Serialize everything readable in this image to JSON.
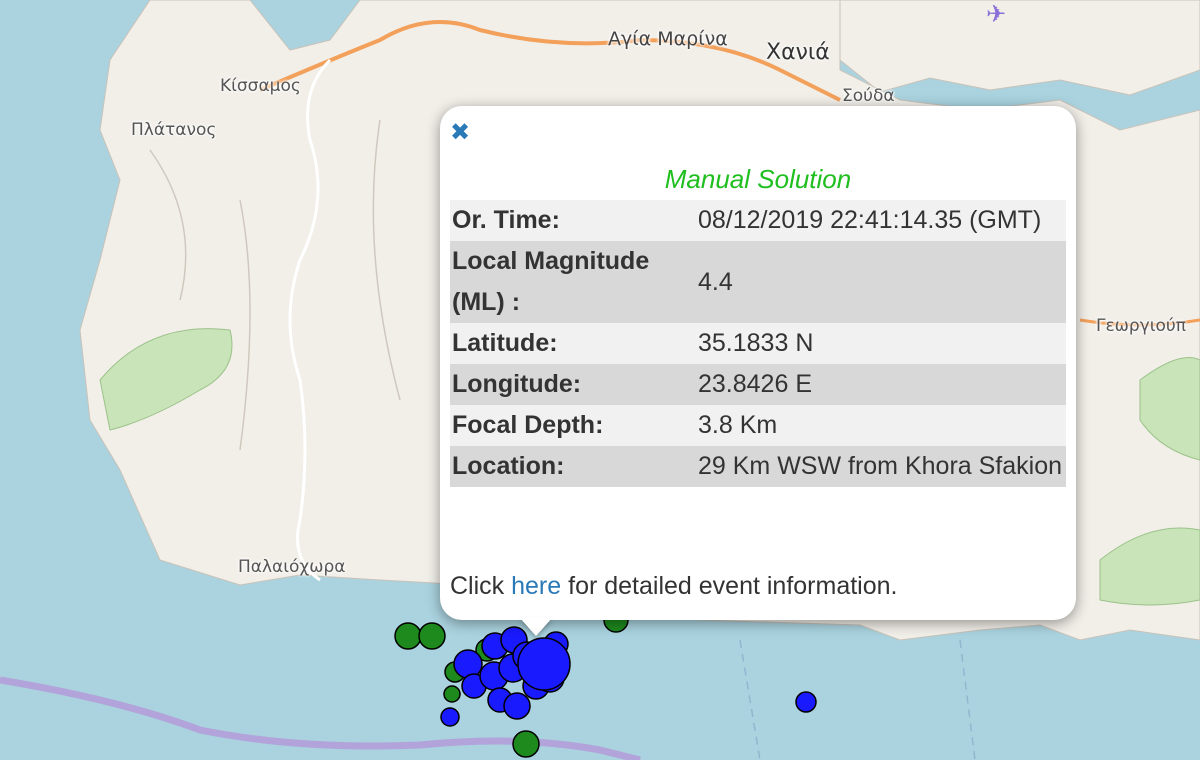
{
  "map": {
    "places": {
      "agia_marina": "Αγία Μαρίνα",
      "chania": "Χανιά",
      "souda": "Σούδα",
      "kissamos": "Κίσσαμος",
      "platanos": "Πλάτανος",
      "georgioupoli": "Γεωργιούπ",
      "paleochora": "Παλαιόχωρα"
    },
    "colors": {
      "sea": "#aad3df",
      "land": "#f2efe9",
      "forest": "#c8e4b8",
      "motorway": "#f3a05a",
      "boundary": "#b49ad9",
      "event_recent": "#1a1aff",
      "event_older": "#1e8a1e"
    }
  },
  "popup": {
    "close_icon": "close-icon",
    "title": "Manual Solution",
    "rows": [
      {
        "label": "Or. Time:",
        "value": "08/12/2019 22:41:14.35 (GMT)"
      },
      {
        "label": "Local Magnitude (ML) :",
        "value": "4.4"
      },
      {
        "label": "Latitude:",
        "value": "35.1833 N"
      },
      {
        "label": "Longitude:",
        "value": "23.8426 E"
      },
      {
        "label": "Focal Depth:",
        "value": "3.8 Km"
      },
      {
        "label": "Location:",
        "value": "29 Km WSW from Khora Sfakion"
      }
    ],
    "footer_prefix": "Click",
    "footer_link": "here",
    "footer_suffix": "for detailed event information."
  }
}
